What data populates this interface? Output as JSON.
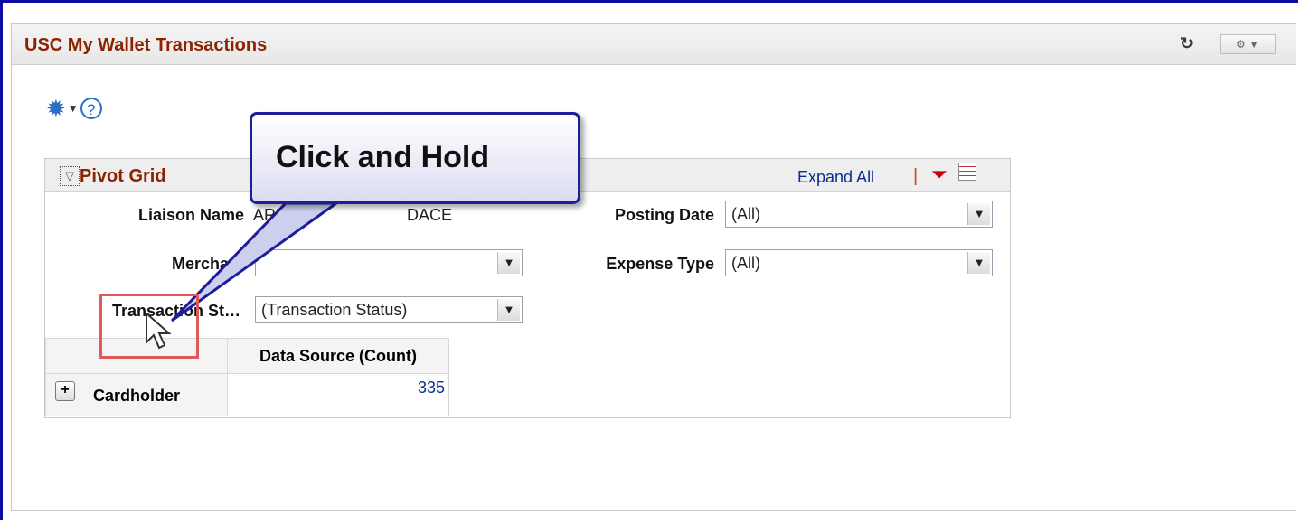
{
  "pagelet": {
    "title": "USC My Wallet Transactions",
    "refresh_icon": "refresh-icon",
    "actions_label": "⚙ ▼"
  },
  "toolbar": {
    "gear_icon": "gear-icon",
    "help_label": "?"
  },
  "pivot_grid": {
    "title": "Pivot Grid",
    "expand_all": "Expand All",
    "separator": "|"
  },
  "filters": {
    "liaison_name_label": "Liaison Name",
    "liaison_name_value": "ARN",
    "liaison_name_value_tail": "DACE",
    "posting_date_label": "Posting Date",
    "posting_date_value": "(All)",
    "merchant_label": "Merchant",
    "merchant_value": "",
    "expense_type_label": "Expense Type",
    "expense_type_value": "(All)",
    "transaction_status_label": "Transaction St…",
    "transaction_status_value": "(Transaction Status)"
  },
  "table": {
    "column_header": "Data Source (Count)",
    "rows": [
      {
        "label": "Cardholder",
        "value": "335"
      }
    ]
  },
  "callout": {
    "text": "Click and Hold"
  },
  "colors": {
    "frame": "#0b0ba2",
    "title": "#8b2200",
    "link": "#0b2e8f",
    "highlight": "#e05a5a"
  }
}
